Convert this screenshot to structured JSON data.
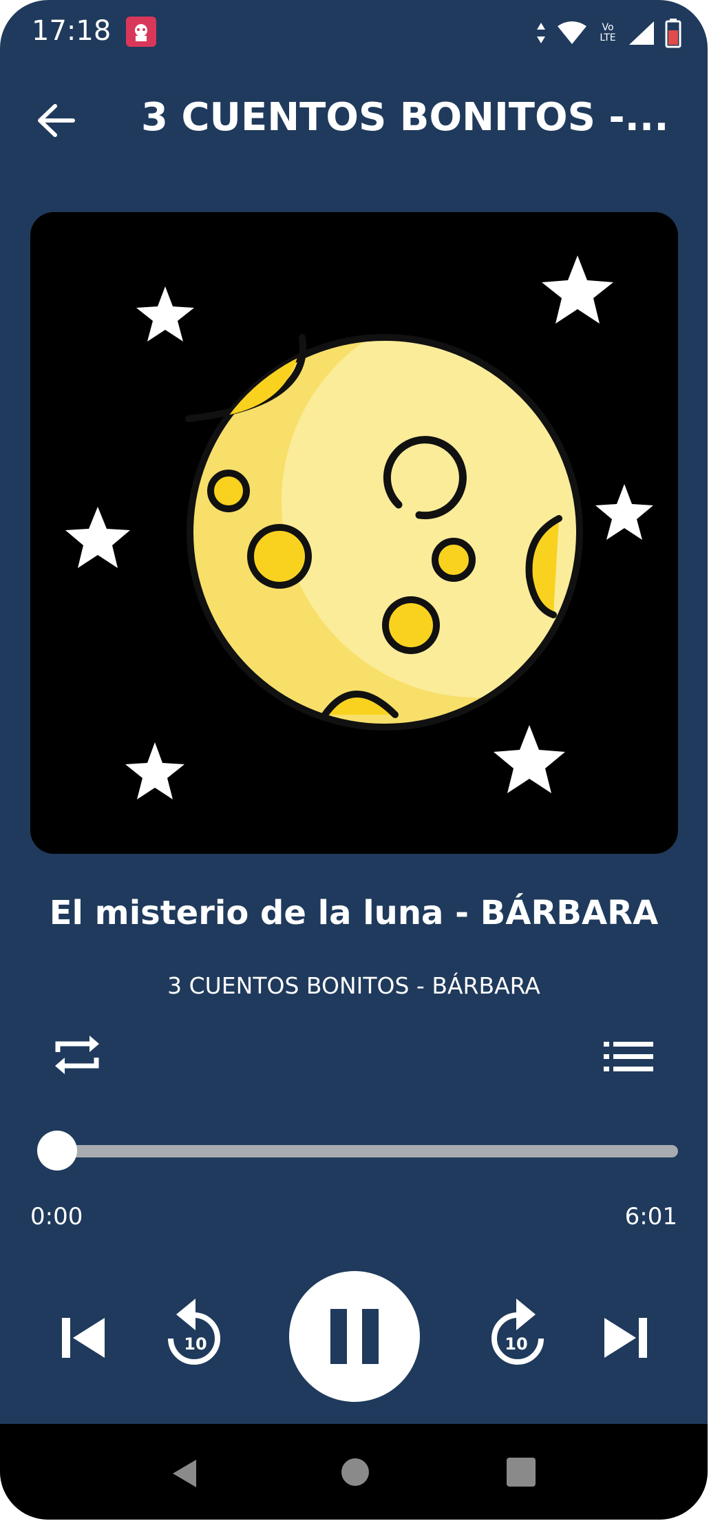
{
  "status_bar": {
    "time": "17:18",
    "network": "Vo LTE",
    "icons": [
      "notification-app-icon",
      "data-arrows-icon",
      "wifi-icon",
      "volte-icon",
      "signal-icon",
      "battery-icon"
    ]
  },
  "header": {
    "title": "3 CUENTOS BONITOS -...",
    "back_icon": "arrow-left-icon"
  },
  "artwork": {
    "subject": "moon-with-stars",
    "background": "#000000",
    "moon_color": "#f7df6a",
    "moon_highlight": "#fbec9a",
    "crater_color": "#f9d21f"
  },
  "track": {
    "title": "El misterio de la luna - BÁRBARA",
    "album": "3 CUENTOS BONITOS - BÁRBARA"
  },
  "controls": {
    "repeat_icon": "repeat-icon",
    "playlist_icon": "queue-list-icon",
    "prev_icon": "skip-previous-icon",
    "rewind_icon": "replay-10-icon",
    "rewind_seconds": "10",
    "play_state_icon": "pause-icon",
    "forward_icon": "forward-10-icon",
    "forward_seconds": "10",
    "next_icon": "skip-next-icon"
  },
  "progress": {
    "current": "0:00",
    "total": "6:01",
    "fraction": 0.0
  },
  "colors": {
    "background": "#1f3a5c",
    "foreground": "#ffffff",
    "track_inactive": "#a8acb1"
  },
  "navbar": {
    "icons": [
      "nav-back-icon",
      "nav-home-icon",
      "nav-recents-icon"
    ]
  }
}
